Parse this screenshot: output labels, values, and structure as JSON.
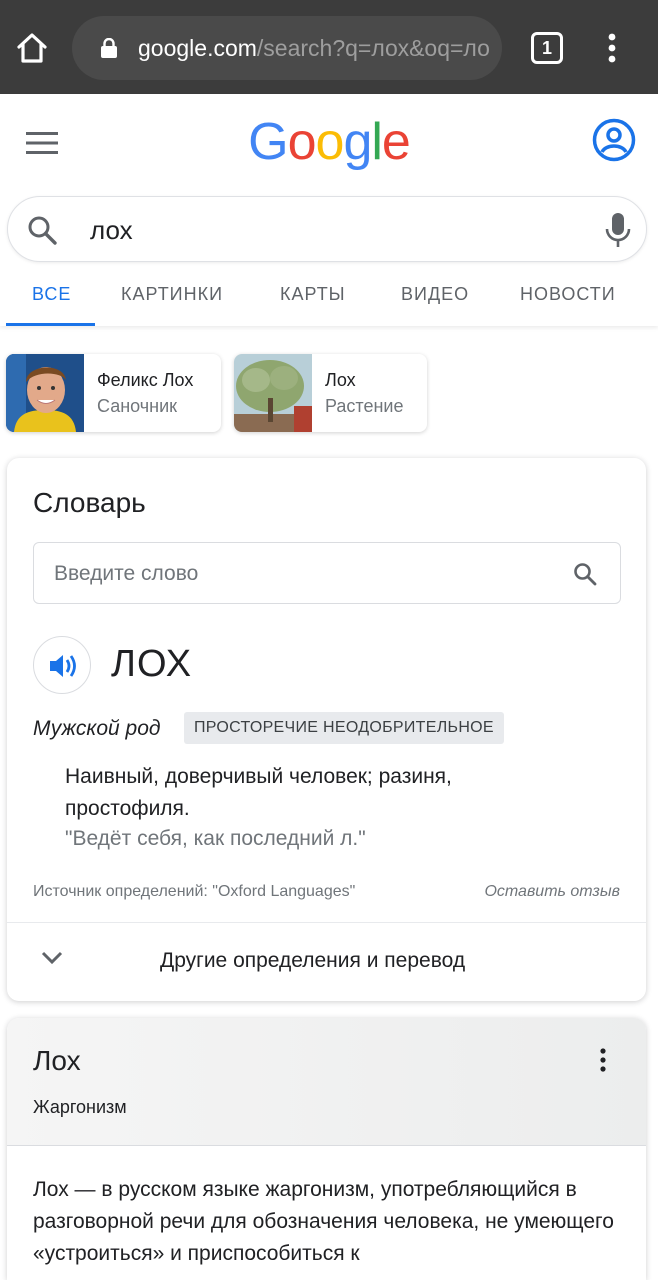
{
  "browser": {
    "url_host": "google.com",
    "url_rest": "/search?q=лох&oq=ло",
    "tab_count": "1"
  },
  "search": {
    "query": "лох",
    "tabs": [
      "ВСЕ",
      "КАРТИНКИ",
      "КАРТЫ",
      "ВИДЕО",
      "НОВОСТИ"
    ],
    "active_tab": "ВСЕ"
  },
  "entities": [
    {
      "name": "Феликс Лох",
      "subtitle": "Саночник"
    },
    {
      "name": "Лох",
      "subtitle": "Растение"
    }
  ],
  "dictionary": {
    "title": "Словарь",
    "input_placeholder": "Введите слово",
    "word": "ЛОХ",
    "part_of_speech": "Мужской род",
    "usage_tag": "ПРОСТОРЕЧИЕ НЕОДОБРИТЕЛЬНОЕ",
    "definition": "Наивный, доверчивый человек; разиня, простофиля.",
    "example": "\"Ведёт себя, как последний л.\"",
    "source": "Источник определений: \"Oxford Languages\"",
    "feedback": "Оставить отзыв",
    "more_label": "Другие определения и перевод"
  },
  "knowledge": {
    "title": "Лох",
    "subtitle": "Жаргонизм",
    "body": "Лох — в русском языке жаргонизм, употребляющийся в разговорной речи для обозначения человека, не умеющего «устроиться» и приспособиться к"
  },
  "colors": {
    "google_blue": "#4285F4",
    "google_red": "#EA4335",
    "google_yellow": "#FBBC05",
    "google_green": "#34A853",
    "accent": "#1a73e8"
  }
}
